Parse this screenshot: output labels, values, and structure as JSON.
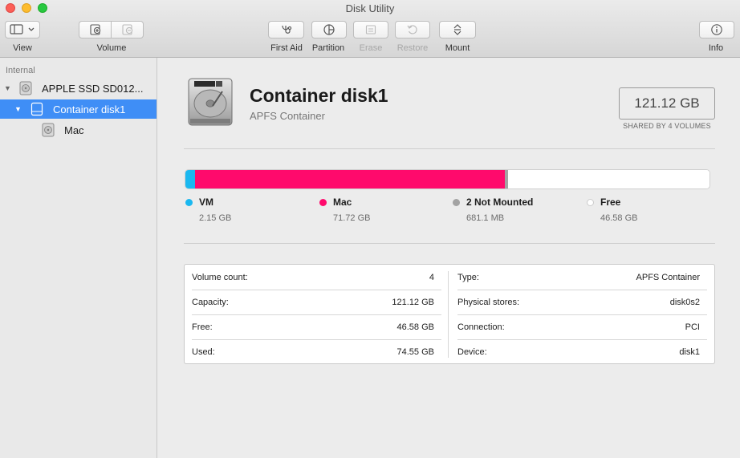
{
  "window": {
    "title": "Disk Utility"
  },
  "toolbar": {
    "view_label": "View",
    "volume_label": "Volume",
    "first_aid_label": "First Aid",
    "partition_label": "Partition",
    "erase_label": "Erase",
    "restore_label": "Restore",
    "mount_label": "Mount",
    "info_label": "Info"
  },
  "sidebar": {
    "section_header": "Internal",
    "items": [
      {
        "label": "APPLE SSD SD012...",
        "icon": "internal-disk-icon"
      },
      {
        "label": "Container disk1",
        "icon": "container-icon",
        "selected": true
      },
      {
        "label": "Mac",
        "icon": "volume-disk-icon"
      }
    ]
  },
  "disk": {
    "name": "Container disk1",
    "subtitle": "APFS Container",
    "size": "121.12 GB",
    "size_caption": "SHARED BY 4 VOLUMES"
  },
  "usage": {
    "total_gb": 121.12,
    "segments": [
      {
        "name": "VM",
        "value": "2.15 GB",
        "gb": 2.15,
        "color": "#1ab8f0"
      },
      {
        "name": "Mac",
        "value": "71.72 GB",
        "gb": 71.72,
        "color": "#ff0a6c"
      },
      {
        "name": "2 Not Mounted",
        "value": "681.1 MB",
        "gb": 0.6811,
        "color": "#a3a3a3"
      },
      {
        "name": "Free",
        "value": "46.58 GB",
        "gb": 46.58,
        "color": "#ffffff"
      }
    ]
  },
  "details": {
    "left": [
      {
        "key": "Volume count:",
        "value": "4"
      },
      {
        "key": "Capacity:",
        "value": "121.12 GB"
      },
      {
        "key": "Free:",
        "value": "46.58 GB"
      },
      {
        "key": "Used:",
        "value": "74.55 GB"
      }
    ],
    "right": [
      {
        "key": "Type:",
        "value": "APFS Container"
      },
      {
        "key": "Physical stores:",
        "value": "disk0s2"
      },
      {
        "key": "Connection:",
        "value": "PCI"
      },
      {
        "key": "Device:",
        "value": "disk1"
      }
    ]
  }
}
